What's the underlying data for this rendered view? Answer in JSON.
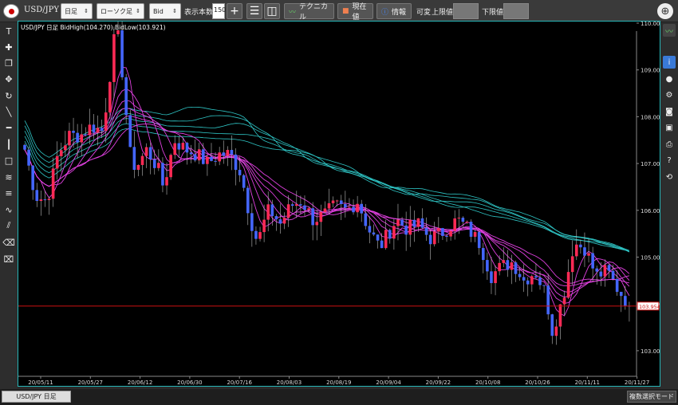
{
  "toolbar": {
    "pair": "USD/JPY",
    "timeframe": "日足",
    "chart_type": "ローソク足",
    "price_type": "Bid",
    "display_count_label": "表示本数",
    "display_count": "150",
    "technical_label": "テクニカル",
    "current_value_label": "現在値",
    "info_label": "情報",
    "variable_label": "可変",
    "upper_limit_label": "上限値",
    "lower_limit_label": "下限値"
  },
  "chart": {
    "title": "USD/JPY 日足  BidHigh(104.270),BidLow(103.921)",
    "current_price_label": "103.954"
  },
  "chart_data": {
    "type": "candlestick",
    "y_ticks": [
      "110.000",
      "109.000",
      "108.000",
      "107.000",
      "106.000",
      "105.000",
      "104.000",
      "103.000"
    ],
    "ylim": [
      103.0,
      110.0
    ],
    "x_ticks": [
      "20/05/11",
      "20/05/27",
      "20/06/12",
      "20/06/30",
      "20/07/16",
      "20/08/03",
      "20/08/19",
      "20/09/04",
      "20/09/22",
      "20/10/08",
      "20/10/26",
      "20/11/11",
      "20/11/27"
    ],
    "current_price": 103.954,
    "candle_count": 150,
    "colors": {
      "up": "#ff2a55",
      "down": "#4466ff",
      "ma_slow": "#2ec4c4",
      "ma_fast": "#e040e0",
      "price_line": "#cc1111"
    }
  },
  "bottom": {
    "tab_label": "USD/JPY 日足",
    "mode_button": "複数選択モード"
  },
  "icons": {
    "left": [
      "text-tool-icon",
      "crosshair-icon",
      "layers-icon",
      "move-icon",
      "rotate-icon",
      "trendline-icon",
      "horizontal-line-icon",
      "vertical-line-icon",
      "rectangle-icon",
      "fibonacci-fan-icon",
      "fibonacci-retracement-icon",
      "wave-icon",
      "channel-icon",
      "eraser-icon",
      "delete-icon"
    ],
    "right": [
      "technical-chart-icon",
      "info-icon",
      "bulb-icon",
      "gear-icon",
      "camera-icon",
      "save-icon",
      "print-icon",
      "help-icon",
      "refresh-icon"
    ]
  }
}
